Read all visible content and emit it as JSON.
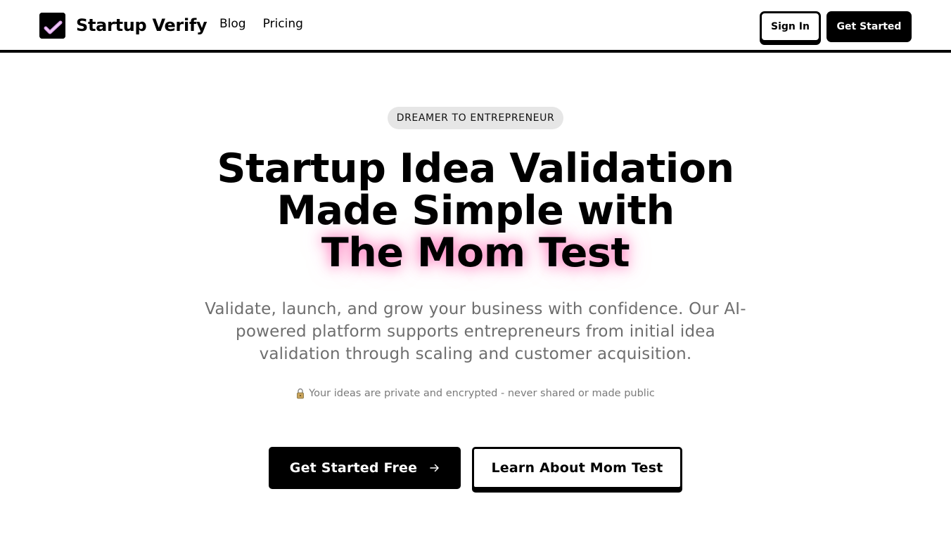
{
  "header": {
    "brand_name": "Startup Verify",
    "logo_icon": "checkmark-logo-icon",
    "nav": [
      {
        "label": "Blog"
      },
      {
        "label": "Pricing"
      }
    ],
    "sign_in_label": "Sign In",
    "get_started_label": "Get Started"
  },
  "hero": {
    "badge": "DREAMER TO ENTREPRENEUR",
    "headline_line1": "Startup Idea Validation",
    "headline_line2": "Made Simple with",
    "headline_highlight": "The Mom Test",
    "subtext": "Validate, launch, and grow your business with confidence. Our AI-powered platform supports entrepreneurs from initial idea validation through scaling and customer acquisition.",
    "privacy_icon": "lock-icon",
    "privacy_note": "Your ideas are private and encrypted - never shared or made public",
    "cta_primary": "Get Started Free",
    "cta_primary_icon": "arrow-right-icon",
    "cta_secondary": "Learn About Mom Test"
  },
  "colors": {
    "primary": "#000000",
    "background": "#ffffff",
    "badge_bg": "#e6e6e6",
    "highlight_glow": "#ff69b4",
    "muted_text": "#6e6e6e",
    "logo_check": "#d8a0e8"
  }
}
